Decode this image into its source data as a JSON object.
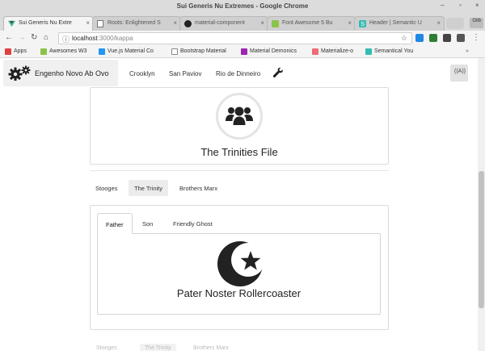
{
  "browser": {
    "window_title": "Sui Generis Nu Extremes - Google Chrome",
    "tabs": [
      {
        "label": "Sui Generis Nu Extre",
        "favicon_color": "#41b883",
        "active": true
      },
      {
        "label": "Roots: Enlightened S",
        "favicon_color": "#888888",
        "active": false
      },
      {
        "label": "material-component",
        "favicon_color": "#222222",
        "active": false
      },
      {
        "label": "Font Awesome 5 Bu",
        "favicon_color": "#8bc34a",
        "active": false
      },
      {
        "label": "Header | Semantic U",
        "favicon_color": "#35bdb2",
        "active": false
      }
    ],
    "profile_label": "Gilb",
    "url_host": "localhost",
    "url_path": ":3000/kappa",
    "bookmarks": [
      {
        "label": "Apps",
        "icon_color": "#e04040"
      },
      {
        "label": "Awesomes W3",
        "icon_color": "#8bc34a"
      },
      {
        "label": "Vue.js Material Co",
        "icon_color": "#2196f3"
      },
      {
        "label": "Bootstrap Material",
        "icon_color": "#888888"
      },
      {
        "label": "Material Demonics",
        "icon_color": "#9c27b0"
      },
      {
        "label": "Materialize-o",
        "icon_color": "#ee6e73"
      },
      {
        "label": "Semantical You",
        "icon_color": "#35bdb2"
      }
    ]
  },
  "app": {
    "brand_name": "Engenho Novo Ab Ovo",
    "nav_links": [
      "Crooklyn",
      "San Paviov",
      "Rio de Dinneiro"
    ],
    "right_button_icon": "accessibility-icon"
  },
  "top_card": {
    "icon": "users-icon",
    "title": "The Trinities File"
  },
  "pill_tabs": [
    {
      "label": "Stooges",
      "active": false
    },
    {
      "label": "The Trinity",
      "active": true
    },
    {
      "label": "Brothers Marx",
      "active": false
    }
  ],
  "inner_tabs": [
    {
      "label": "Father",
      "active": true
    },
    {
      "label": "Son",
      "active": false
    },
    {
      "label": "Friendly Ghost",
      "active": false
    }
  ],
  "inner_card": {
    "icon": "star-and-crescent-icon",
    "title": "Pater Noster Rollercoaster"
  },
  "peek_tabs": [
    {
      "label": "Stooges",
      "active": false
    },
    {
      "label": "The Trinity",
      "active": true
    },
    {
      "label": "Brothers Marx",
      "active": false
    }
  ]
}
